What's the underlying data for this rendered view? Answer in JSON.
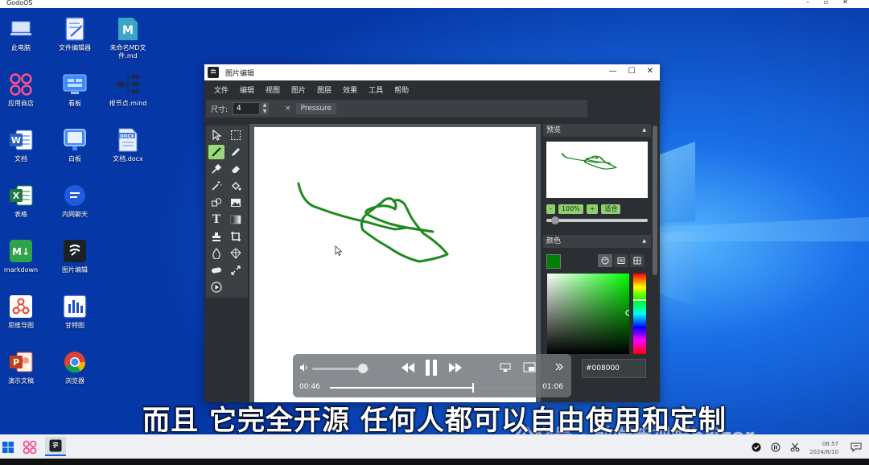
{
  "host": {
    "title": "GodoOS"
  },
  "desktop": {
    "icons": [
      {
        "name": "computer-icon",
        "label": "此电脑"
      },
      {
        "name": "text-editor-icon",
        "label": "文件编辑器"
      },
      {
        "name": "markdown-file-icon",
        "label": "未命名MD文件.md"
      },
      {
        "name": "app-store-icon",
        "label": "应用商店"
      },
      {
        "name": "dashboard-icon",
        "label": "看板"
      },
      {
        "name": "mindmap-file-icon",
        "label": "根节点.mind"
      },
      {
        "name": "word-doc-icon",
        "label": "文档"
      },
      {
        "name": "whiteboard-icon",
        "label": "白板"
      },
      {
        "name": "docx-file-icon",
        "label": "文档.docx"
      },
      {
        "name": "excel-sheet-icon",
        "label": "表格"
      },
      {
        "name": "intranet-chat-icon",
        "label": "内网聊天"
      },
      {
        "name": "markdown-app-icon",
        "label": "markdown"
      },
      {
        "name": "image-editor-icon",
        "label": "图片编辑"
      },
      {
        "name": "mind-map-app-icon",
        "label": "思维导图"
      },
      {
        "name": "gantt-chart-icon",
        "label": "甘特图"
      },
      {
        "name": "ppt-presentation-icon",
        "label": "演示文稿"
      },
      {
        "name": "browser-icon",
        "label": "浏览器"
      }
    ],
    "md_badge": "M",
    "docx_badge": "DOCX",
    "md_app_badge": "M↓"
  },
  "app": {
    "title": "图片编辑",
    "menu": [
      "文件",
      "编辑",
      "视图",
      "图片",
      "图层",
      "效果",
      "工具",
      "帮助"
    ],
    "options": {
      "size_label": "尺寸:",
      "size_value": "4",
      "pressure_label": "Pressure",
      "remove_glyph": "×"
    },
    "panels": {
      "preview_title": "预览",
      "zoom_minus": "-",
      "zoom_value": "100%",
      "zoom_plus": "+",
      "zoom_fit": "适合",
      "zoom_level": 0.05,
      "color_title": "颜色",
      "hex_value": "#008000",
      "current_color": "#008000"
    },
    "stroke_color": "#1f8a1f"
  },
  "video": {
    "current_time": "00:46",
    "total_time": "01:06",
    "progress": 0.697,
    "volume": 0.9
  },
  "subtitle": "而且 它完全开源 任何人都可以自由使用和定制",
  "watermark": "公众号 · 前端新视野brizer",
  "taskbar": {
    "time": "08:57",
    "date": "2024/8/10"
  }
}
